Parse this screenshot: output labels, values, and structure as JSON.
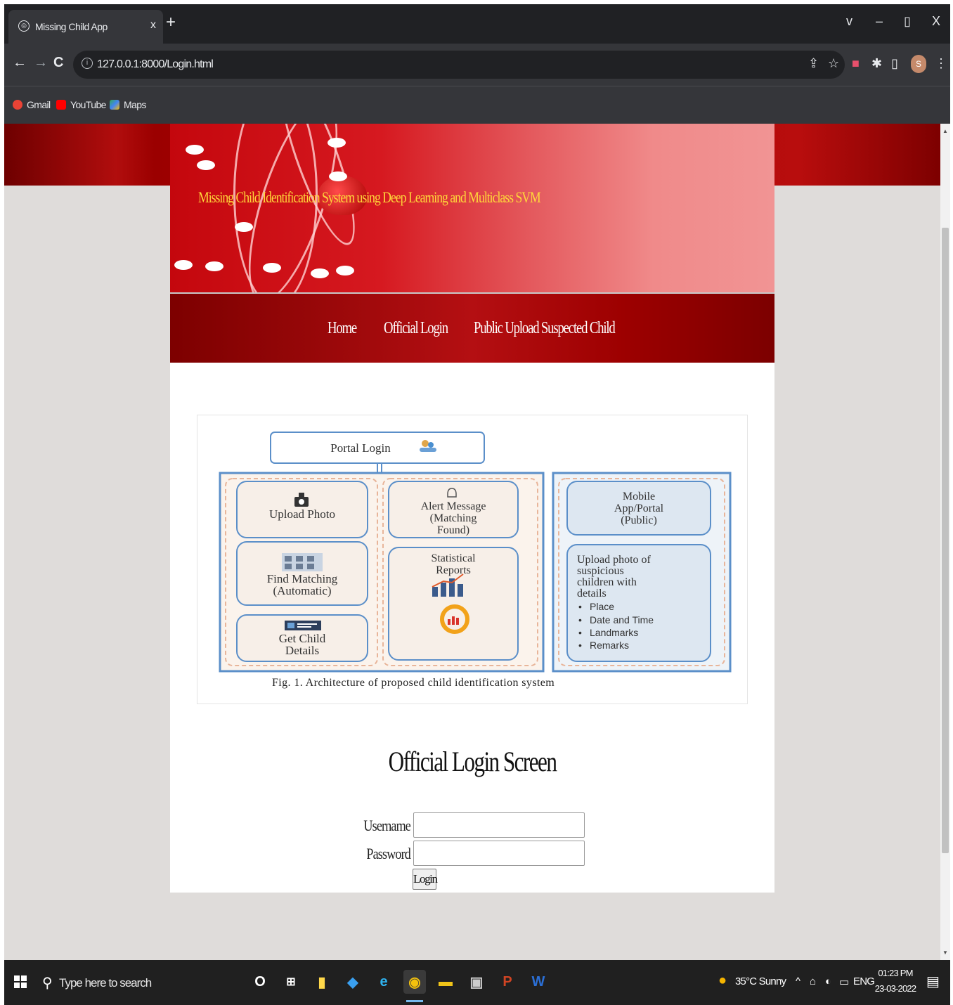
{
  "browser": {
    "tab_title": "Missing Child App",
    "tab_close": "x",
    "new_tab": "+",
    "window_controls": [
      "v",
      "–",
      "▯",
      "X"
    ],
    "url": "127.0.0.1:8000/Login.html",
    "bookmarks": [
      {
        "label": "Gmail",
        "color": "#ea4335"
      },
      {
        "label": "YouTube",
        "color": "#ff0000"
      },
      {
        "label": "Maps",
        "color": "#34a853"
      }
    ],
    "profile_initial": "S"
  },
  "site": {
    "title": "Missing Child Identification System using Deep Learning and Multiclass SVM",
    "nav": [
      "Home",
      "Official Login",
      "Public Upload Suspected Child"
    ]
  },
  "figure": {
    "portal_login": "Portal Login",
    "upload_photo": "Upload Photo",
    "alert_message": [
      "Alert Message",
      "(Matching",
      "Found)"
    ],
    "find_matching": [
      "Find Matching",
      "(Automatic)"
    ],
    "statistical_reports": [
      "Statistical",
      "Reports"
    ],
    "get_child_details": [
      "Get Child",
      "Details"
    ],
    "mobile_app": [
      "Mobile",
      "App/Portal",
      "(Public)"
    ],
    "upload_suspicious": [
      "Upload photo of",
      "suspicious",
      "children with",
      "details"
    ],
    "bullets": [
      "Place",
      "Date and Time",
      "Landmarks",
      "Remarks"
    ],
    "caption": "Fig. 1.    Architecture of proposed child identification system"
  },
  "login": {
    "heading": "Official Login Screen",
    "username_label": "Username",
    "password_label": "Password",
    "username_value": "",
    "password_value": "",
    "button": "Login"
  },
  "taskbar": {
    "search_placeholder": "Type here to search",
    "weather": "35°C  Sunny",
    "tray_text": "ENG",
    "time": "01:23 PM",
    "date": "23-03-2022"
  }
}
